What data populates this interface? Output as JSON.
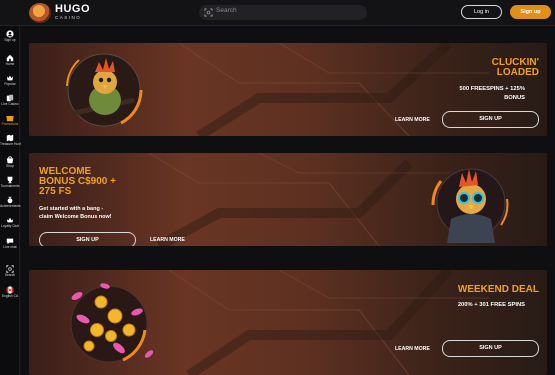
{
  "header": {
    "logo_title": "HUGO",
    "logo_sub": "CASINO",
    "search_placeholder": "Search",
    "login_label": "Log in",
    "signup_label": "Sign up"
  },
  "sidebar": {
    "items": [
      {
        "label": "Sign up",
        "icon": "user-icon"
      },
      {
        "label": "Home",
        "icon": "home-icon"
      },
      {
        "label": "Popular",
        "icon": "crown-icon"
      },
      {
        "label": "Live Casino",
        "icon": "cards-icon"
      },
      {
        "label": "Promotions",
        "icon": "gift-icon",
        "active": true
      },
      {
        "label": "Treasure Hunt",
        "icon": "treasure-map-icon"
      },
      {
        "label": "Shop",
        "icon": "shop-icon"
      },
      {
        "label": "Tournaments",
        "icon": "trophy-icon"
      },
      {
        "label": "Achievements",
        "icon": "medal-icon"
      },
      {
        "label": "Loyalty Club",
        "icon": "crown-club-icon"
      },
      {
        "label": "Live chat",
        "icon": "chat-icon"
      },
      {
        "label": "Search",
        "icon": "search-icon"
      },
      {
        "label": "English CA",
        "icon": "canada-flag-icon"
      }
    ]
  },
  "banners": [
    {
      "title_lines": [
        "CLUCKIN'",
        "LOADED"
      ],
      "sub_lines": [
        "500 FREESPINS + 125%",
        "BONUS"
      ],
      "more_label": "LEARN MORE",
      "signup_label": "SIGN UP"
    },
    {
      "title_lines": [
        "WELCOME",
        "BONUS C$900 +",
        "275 FS"
      ],
      "sub_lines": [
        "Get started with a bang -",
        "claim Welcome Bonus now!"
      ],
      "more_label": "LEARN MORE",
      "signup_label": "SIGN UP"
    },
    {
      "title_lines": [
        "WEEKEND DEAL"
      ],
      "sub_lines": [
        "200% + 301 FREE SPINS"
      ],
      "more_label": "LEARN MORE",
      "signup_label": "SIGN UP"
    }
  ],
  "colors": {
    "accent": "#e09016",
    "title_orange": "#f2a020",
    "background": "#0f0f11"
  }
}
